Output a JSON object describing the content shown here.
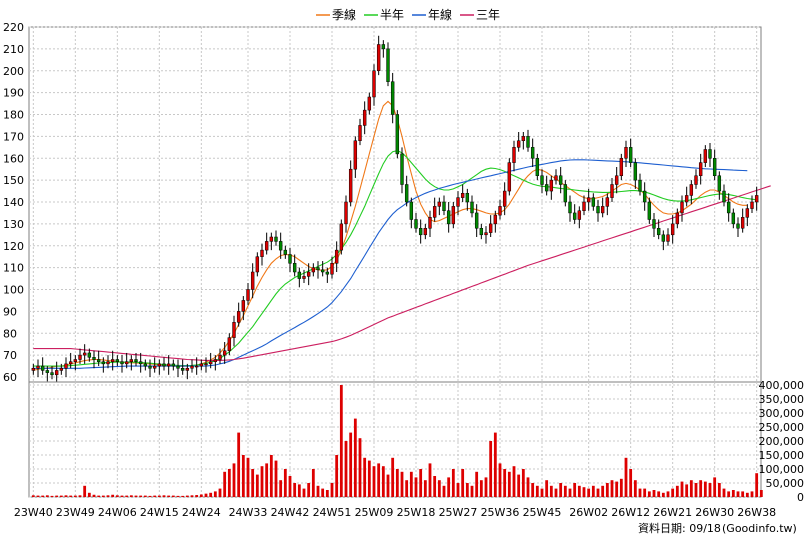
{
  "chart_data": [
    {
      "type": "candlestick-line",
      "panel": "price",
      "legend": [
        {
          "name": "季線",
          "color": "#f07818"
        },
        {
          "name": "半年",
          "color": "#22cc22"
        },
        {
          "name": "年線",
          "color": "#1e5fd0"
        },
        {
          "name": "三年",
          "color": "#cc1f60"
        }
      ],
      "ylim": [
        60,
        220
      ],
      "y_ticks": [
        "220",
        "210",
        "200",
        "190",
        "180",
        "170",
        "160",
        "150",
        "140",
        "130",
        "120",
        "110",
        "100",
        "90",
        "80",
        "70",
        "60"
      ],
      "x_tick_labels": [
        "23W40",
        "23W49",
        "24W06",
        "24W15",
        "24W24",
        "24W33",
        "24W42",
        "24W51",
        "25W09",
        "25W18",
        "25W27",
        "25W36",
        "25W45",
        "26W02",
        "26W12",
        "26W21",
        "26W30",
        "26W38"
      ],
      "weeks_count": 156,
      "close": [
        64,
        65,
        63,
        62,
        61,
        63,
        64,
        66,
        67,
        68,
        70,
        71,
        69,
        68,
        67,
        66,
        67,
        68,
        67,
        66,
        67,
        68,
        67,
        66,
        65,
        64,
        65,
        66,
        65,
        66,
        65,
        64,
        63,
        64,
        65,
        65,
        66,
        66,
        67,
        68,
        70,
        72,
        78,
        85,
        90,
        95,
        100,
        108,
        115,
        118,
        122,
        124,
        122,
        118,
        116,
        112,
        108,
        105,
        106,
        108,
        110,
        109,
        108,
        107,
        112,
        118,
        130,
        140,
        155,
        168,
        175,
        182,
        188,
        200,
        212,
        210,
        195,
        180,
        162,
        148,
        140,
        132,
        128,
        125,
        128,
        133,
        138,
        140,
        136,
        130,
        138,
        142,
        144,
        140,
        135,
        128,
        125,
        126,
        130,
        134,
        138,
        145,
        158,
        165,
        168,
        170,
        165,
        160,
        152,
        148,
        145,
        150,
        152,
        148,
        140,
        135,
        132,
        136,
        140,
        142,
        138,
        135,
        138,
        142,
        148,
        152,
        160,
        165,
        158,
        150,
        145,
        140,
        132,
        128,
        125,
        122,
        125,
        130,
        135,
        140,
        143,
        148,
        152,
        158,
        164,
        160,
        152,
        145,
        140,
        135,
        130,
        128,
        133,
        137,
        140,
        143
      ],
      "ma_quarter": [
        63,
        63.5,
        64,
        64,
        64.5,
        65,
        65,
        65.5,
        66,
        66.5,
        67,
        67.5,
        67.8,
        68,
        68,
        67.8,
        67.5,
        67.3,
        67,
        66.8,
        66.6,
        66.5,
        66.4,
        66.3,
        66.2,
        66,
        65.8,
        65.6,
        65.4,
        65.2,
        65,
        64.9,
        64.9,
        65,
        65.2,
        65.5,
        66,
        66.8,
        67.8,
        69,
        71,
        73.5,
        76.5,
        80,
        84,
        88,
        92.5,
        97,
        101.5,
        105.5,
        109,
        112,
        114,
        115.5,
        116,
        115.8,
        115,
        113.5,
        112,
        110.5,
        109.5,
        109,
        108.8,
        109,
        110.5,
        113.5,
        118,
        124,
        131,
        138,
        146,
        154,
        162,
        170,
        178,
        184,
        186,
        184,
        178,
        170,
        161,
        153,
        145,
        139,
        135,
        132,
        131,
        131.5,
        132.5,
        133.5,
        134.5,
        135.5,
        136.5,
        137,
        137,
        136.5,
        135.8,
        135,
        134.5,
        134.5,
        135,
        136.5,
        139,
        142.5,
        146,
        149.5,
        152,
        154,
        155,
        154.5,
        153.5,
        152,
        150.5,
        149,
        147.5,
        146,
        144.5,
        143,
        142,
        141.5,
        141.5,
        142,
        142.5,
        143.5,
        145,
        146.5,
        148,
        148.5,
        148,
        147,
        145.5,
        143.5,
        141,
        138.5,
        136.5,
        135,
        134.5,
        134.5,
        135,
        136,
        137.5,
        139,
        141,
        143,
        144.5,
        145.5,
        145.5,
        144.5,
        143,
        141.5,
        140,
        139,
        138.5,
        138.5
      ],
      "ma_half": [
        65,
        65,
        65,
        65,
        65,
        65,
        65,
        65,
        65.2,
        65.4,
        65.6,
        65.8,
        66,
        66.2,
        66.4,
        66.5,
        66.6,
        66.7,
        66.8,
        66.8,
        66.8,
        66.8,
        66.7,
        66.6,
        66.5,
        66.3,
        66.1,
        65.9,
        65.7,
        65.5,
        65.4,
        65.3,
        65.2,
        65.2,
        65.3,
        65.5,
        65.8,
        66.2,
        66.8,
        67.5,
        68.5,
        70,
        71.5,
        73.5,
        75.5,
        78,
        80.5,
        83,
        86,
        89,
        92,
        95,
        98,
        100.5,
        102.5,
        104,
        105.5,
        106.5,
        107.5,
        108.5,
        109.5,
        110.5,
        111.5,
        112.5,
        114,
        116,
        118.5,
        121.5,
        125,
        129,
        133.5,
        138,
        143,
        148,
        153,
        157.5,
        161,
        163,
        163.5,
        162.5,
        160.5,
        158,
        155.5,
        153,
        150.5,
        148.5,
        147,
        146,
        145.5,
        145.5,
        146,
        147,
        148,
        149.5,
        151,
        152.5,
        154,
        155,
        155.5,
        155.3,
        154.8,
        154,
        153,
        152,
        151,
        150,
        149,
        148.2,
        147.6,
        147.2,
        147,
        146.8,
        146.5,
        146.2,
        146,
        145.8,
        145.5,
        145.2,
        145,
        144.8,
        144.6,
        144.5,
        144.4,
        144.4,
        144.5,
        144.6,
        144.8,
        145,
        145.2,
        145.2,
        145,
        144.6,
        144,
        143.2,
        142.4,
        141.6,
        141,
        140.6,
        140.4,
        140.4,
        140.6,
        141,
        141.5,
        142,
        142.5,
        143,
        143.4,
        143.6,
        143.6,
        143.4,
        143,
        142.5,
        142,
        141.6,
        141.3,
        141
      ],
      "ma_year": [
        64,
        64,
        64,
        64,
        64,
        64,
        64,
        64,
        64,
        64,
        64,
        64.1,
        64.2,
        64.3,
        64.4,
        64.5,
        64.6,
        64.7,
        64.8,
        64.9,
        65,
        65,
        65,
        65,
        65,
        65,
        65,
        65,
        65,
        65,
        65,
        65,
        65,
        65,
        65,
        65,
        65,
        65,
        65.2,
        65.5,
        66,
        66.5,
        67.2,
        68,
        69,
        70,
        71,
        72,
        73,
        74,
        75.2,
        76.5,
        77.8,
        79,
        80.2,
        81.4,
        82.6,
        83.8,
        85,
        86.3,
        87.6,
        89,
        90.5,
        92,
        94,
        96.5,
        99,
        102,
        105,
        108.5,
        112,
        115.5,
        119,
        122.5,
        126,
        129,
        132,
        134.5,
        136.5,
        138,
        139.5,
        140.8,
        142,
        143,
        144,
        144.8,
        145.5,
        146.2,
        146.8,
        147.4,
        148,
        148.5,
        149,
        149.5,
        150,
        150.5,
        151,
        151.5,
        152,
        152.5,
        153,
        153.5,
        154,
        154.5,
        155,
        155.5,
        156,
        156.4,
        156.8,
        157.2,
        157.6,
        158,
        158.4,
        158.8,
        159,
        159.2,
        159.3,
        159.3,
        159.3,
        159.2,
        159.1,
        159,
        158.9,
        158.8,
        158.7,
        158.6,
        158.5,
        158.4,
        158.3,
        158.1,
        157.9,
        157.7,
        157.5,
        157.3,
        157.1,
        156.9,
        156.7,
        156.5,
        156.3,
        156.1,
        155.9,
        155.7,
        155.5,
        155.3,
        155.2,
        155.1,
        155,
        154.9,
        154.8,
        154.7,
        154.6,
        154.5,
        154.4,
        154.3
      ],
      "ma_three_year": [
        73,
        73,
        73,
        73,
        73,
        73,
        73,
        73,
        73,
        72.8,
        72.6,
        72.4,
        72.2,
        72,
        71.8,
        71.6,
        71.4,
        71.2,
        71,
        70.8,
        70.6,
        70.4,
        70.2,
        70,
        69.8,
        69.6,
        69.4,
        69.2,
        69,
        68.8,
        68.6,
        68.4,
        68.2,
        68,
        67.9,
        67.8,
        67.7,
        67.6,
        67.6,
        67.6,
        67.6,
        67.7,
        67.8,
        68,
        68.3,
        68.6,
        69,
        69.4,
        69.8,
        70.2,
        70.6,
        71,
        71.4,
        71.8,
        72.2,
        72.6,
        73,
        73.4,
        73.8,
        74.2,
        74.6,
        75,
        75.4,
        75.8,
        76.2,
        76.8,
        77.4,
        78.2,
        79,
        80,
        81,
        82,
        83,
        84,
        85,
        86,
        87,
        87.8,
        88.6,
        89.4,
        90.2,
        91,
        91.8,
        92.6,
        93.4,
        94.2,
        95,
        95.8,
        96.6,
        97.4,
        98.2,
        99,
        99.8,
        100.6,
        101.4,
        102.2,
        103,
        103.8,
        104.6,
        105.4,
        106.2,
        107,
        107.8,
        108.6,
        109.4,
        110.2,
        111,
        111.7,
        112.4,
        113.1,
        113.8,
        114.5,
        115.2,
        115.9,
        116.6,
        117.3,
        118,
        118.7,
        119.4,
        120.1,
        120.8,
        121.5,
        122.2,
        122.9,
        123.6,
        124.3,
        125,
        125.7,
        126.4,
        127.1,
        127.8,
        128.5,
        129.2,
        129.9,
        130.6,
        131.3,
        132,
        132.7,
        133.4,
        134.1,
        134.8,
        135.5,
        136.2,
        136.9,
        137.6,
        138.3,
        139,
        139.7,
        140.4,
        141.1,
        141.8,
        142.5,
        143.2,
        143.9,
        144.6,
        145.3,
        146,
        146.7,
        147.4
      ]
    },
    {
      "type": "bar",
      "panel": "volume",
      "series_color": "#dd0000",
      "ylim": [
        0,
        400000
      ],
      "y_ticks": [
        "400,000",
        "350,000",
        "300,000",
        "250,000",
        "200,000",
        "150,000",
        "100,000",
        "50,000",
        "0"
      ],
      "values": [
        6000,
        5000,
        5000,
        6000,
        4000,
        5000,
        5000,
        6000,
        5000,
        5000,
        6000,
        40000,
        15000,
        8000,
        5000,
        5000,
        6000,
        8000,
        6000,
        5000,
        5000,
        6000,
        5000,
        5000,
        5000,
        4000,
        5000,
        5000,
        6000,
        5000,
        5000,
        4000,
        4000,
        5000,
        6000,
        7000,
        9000,
        12000,
        15000,
        20000,
        30000,
        90000,
        100000,
        120000,
        230000,
        150000,
        140000,
        100000,
        80000,
        110000,
        120000,
        150000,
        130000,
        60000,
        100000,
        75000,
        50000,
        45000,
        30000,
        50000,
        100000,
        40000,
        30000,
        25000,
        50000,
        150000,
        400000,
        200000,
        230000,
        280000,
        210000,
        140000,
        130000,
        110000,
        120000,
        110000,
        80000,
        140000,
        100000,
        90000,
        60000,
        90000,
        70000,
        100000,
        60000,
        120000,
        75000,
        60000,
        40000,
        70000,
        100000,
        50000,
        100000,
        50000,
        40000,
        90000,
        60000,
        70000,
        200000,
        230000,
        120000,
        100000,
        90000,
        110000,
        80000,
        100000,
        70000,
        50000,
        40000,
        30000,
        60000,
        40000,
        30000,
        50000,
        40000,
        30000,
        50000,
        40000,
        35000,
        30000,
        40000,
        30000,
        40000,
        50000,
        60000,
        55000,
        65000,
        140000,
        100000,
        60000,
        30000,
        30000,
        20000,
        25000,
        20000,
        15000,
        20000,
        30000,
        40000,
        55000,
        45000,
        60000,
        50000,
        60000,
        55000,
        50000,
        70000,
        50000,
        30000,
        20000,
        25000,
        20000,
        20000,
        15000,
        20000,
        85000,
        25000
      ]
    }
  ],
  "footer": {
    "date_label": "資料日期: 09/18",
    "source": "(Goodinfo.tw)"
  }
}
